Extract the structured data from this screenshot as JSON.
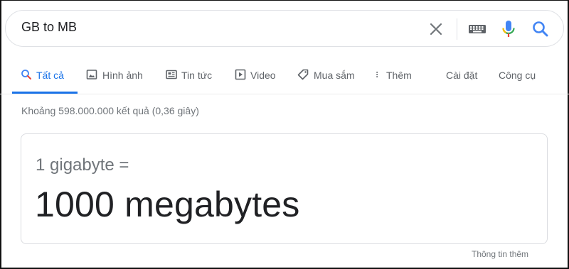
{
  "search": {
    "query": "GB to MB",
    "icons": {
      "clear": "close-icon",
      "keyboard": "keyboard-icon",
      "mic": "microphone-icon",
      "search": "search-icon"
    }
  },
  "tabs": [
    {
      "label": "Tất cả",
      "icon": "search-icon",
      "active": true
    },
    {
      "label": "Hình ảnh",
      "icon": "image-icon"
    },
    {
      "label": "Tin tức",
      "icon": "news-icon"
    },
    {
      "label": "Video",
      "icon": "video-icon"
    },
    {
      "label": "Mua sắm",
      "icon": "tag-icon"
    },
    {
      "label": "Thêm",
      "icon": "more-vert-icon"
    },
    {
      "label": "Cài đặt"
    },
    {
      "label": "Công cụ"
    }
  ],
  "stats": "Khoảng 598.000.000 kết quả (0,36 giây)",
  "converter": {
    "from": "1 gigabyte =",
    "result": "1000 megabytes"
  },
  "more_info": "Thông tin thêm",
  "colors": {
    "accent": "#1a73e8",
    "text": "#202124",
    "muted": "#70757a"
  }
}
